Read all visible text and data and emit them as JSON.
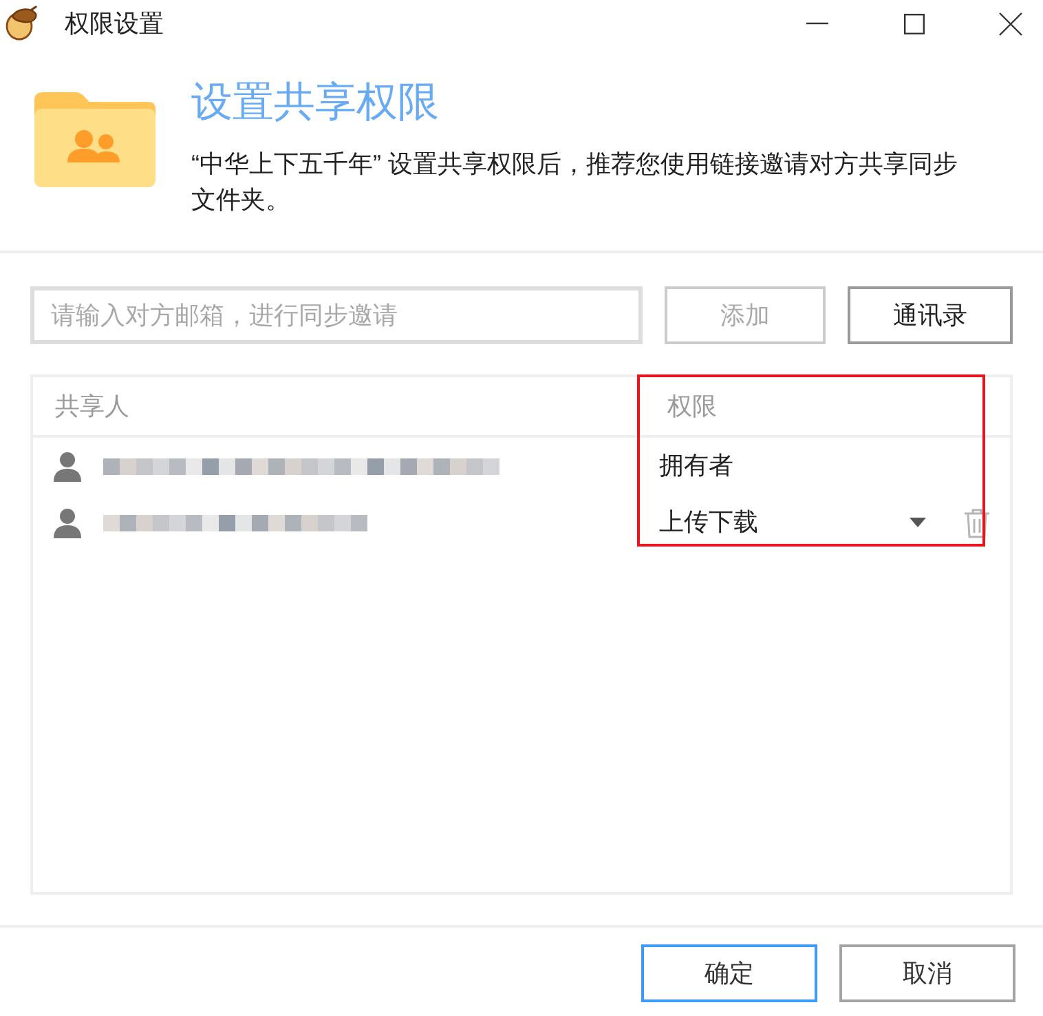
{
  "window": {
    "title": "权限设置"
  },
  "header": {
    "title": "设置共享权限",
    "description": "“中华上下五千年” 设置共享权限后，推荐您使用链接邀请对方共享同步文件夹。"
  },
  "invite": {
    "placeholder": "请输入对方邮箱，进行同步邀请",
    "add_button": {
      "label": "添加",
      "disabled": true
    },
    "contacts_button": {
      "label": "通讯录",
      "disabled": false
    }
  },
  "table": {
    "columns": [
      "共享人",
      "权限"
    ],
    "rows": [
      {
        "kind": "text",
        "permission": "拥有者"
      },
      {
        "kind": "dropdown",
        "permission": "上传下载"
      }
    ]
  },
  "buttons": [
    {
      "label": "确定",
      "focused": true
    },
    {
      "label": "取消",
      "focused": false
    }
  ]
}
